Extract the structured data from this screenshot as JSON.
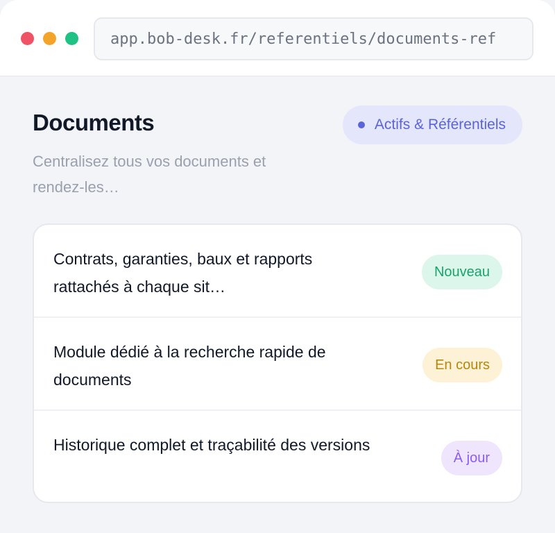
{
  "browser": {
    "url": "app.bob-desk.fr/referentiels/documents-ref"
  },
  "header": {
    "title": "Documents",
    "category_label": "Actifs & Référentiels",
    "subtitle": "Centralisez tous vos documents et rendez-les…"
  },
  "colors": {
    "accent": "#5b63d9",
    "status_new": "#18a46c",
    "status_in_progress": "#b7860b",
    "status_up_to_date": "#8b5cf6"
  },
  "features": [
    {
      "text": "Contrats, garanties, baux et rapports rattachés à chaque sit…",
      "status": "Nouveau",
      "status_color": "#18a46c",
      "status_bg": "#dcf6ec"
    },
    {
      "text": "Module dédié à la recherche rapide de documents",
      "status": "En cours",
      "status_color": "#b7860b",
      "status_bg": "#fdf1d6"
    },
    {
      "text": "Historique complet et traçabilité des versions",
      "status": "À jour",
      "status_color": "#8b5cf6",
      "status_bg": "#efe6fd"
    }
  ]
}
